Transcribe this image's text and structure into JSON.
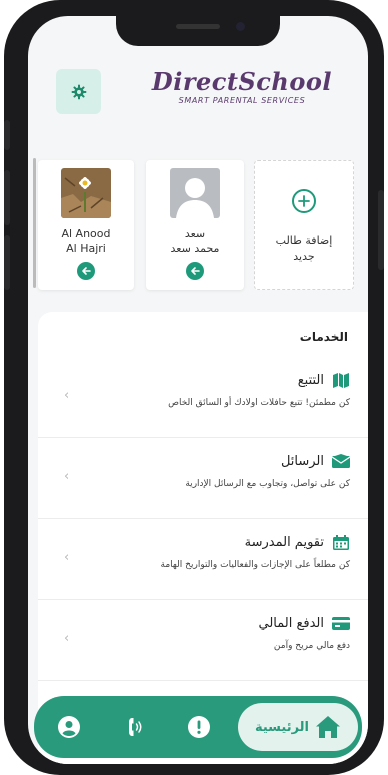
{
  "app": {
    "logo_title": "DirectSchool",
    "logo_subtitle": "SMART PARENTAL SERVICES"
  },
  "colors": {
    "accent": "#2a9a7c",
    "accent_light": "#d7efe9",
    "brand_text": "#5a3a6e"
  },
  "students": [
    {
      "line1": "Al Anood",
      "line2": "Al Hajri"
    },
    {
      "line1": "سعد",
      "line2": "محمد سعد"
    }
  ],
  "add_student": {
    "line1": "إضافة طالب",
    "line2": "جديد"
  },
  "services": {
    "title": "الخدمات",
    "items": [
      {
        "title": "التتبع",
        "desc": "كن مطمئن! تتبع حافلات اولادك أو السائق الخاص",
        "icon": "map-icon"
      },
      {
        "title": "الرسائل",
        "desc": "كن على تواصل، وتجاوب مع الرسائل الإدارية",
        "icon": "envelope-icon"
      },
      {
        "title": "تقويم المدرسة",
        "desc": "كن مطلعاً على الإجازات والفعاليات  والتواريخ الهامة",
        "icon": "calendar-icon"
      },
      {
        "title": "الدفع المالي",
        "desc": "دفع مالي مريح وآمن",
        "icon": "credit-card-icon"
      }
    ]
  },
  "nav": {
    "home_label": "الرئيسية",
    "items": [
      "profile-icon",
      "phone-icon",
      "alert-icon",
      "home-icon"
    ]
  }
}
